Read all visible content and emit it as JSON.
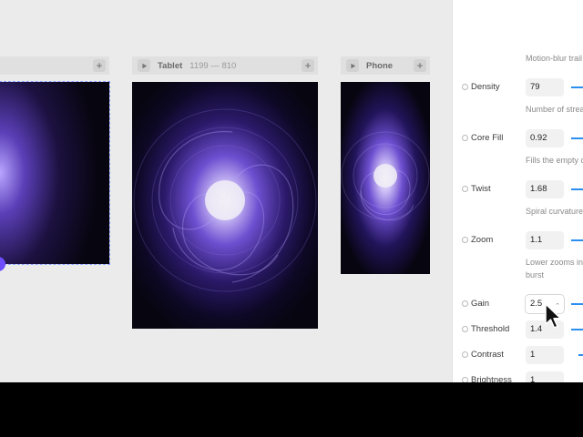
{
  "frames": [
    {
      "title": "",
      "dims": ""
    },
    {
      "title": "Tablet",
      "dims": "1199 — 810"
    },
    {
      "title": "Phone",
      "dims": ""
    }
  ],
  "panel": {
    "top_caption": "Motion-blur trail",
    "params": [
      {
        "label": "Density",
        "value": "79",
        "caption": "Number of streaks"
      },
      {
        "label": "Core Fill",
        "value": "0.92",
        "caption": "Fills the empty center"
      },
      {
        "label": "Twist",
        "value": "1.68",
        "caption": "Spiral curvature"
      },
      {
        "label": "Zoom",
        "value": "1.1",
        "caption_line1": "Lower zooms into",
        "caption_line2": "burst"
      },
      {
        "label": "Gain",
        "value": "2.5"
      },
      {
        "label": "Threshold",
        "value": "1.4"
      },
      {
        "label": "Contrast",
        "value": "1"
      },
      {
        "label": "Brightness",
        "value": "1"
      }
    ]
  },
  "colors": {
    "accent": "#2a8ff0",
    "selection": "#6e4dff",
    "preview_bg": "#07050f"
  },
  "icons": {
    "play": "play-icon",
    "plus": "plus-icon",
    "param": "parameter-dot-icon",
    "cursor": "mouse-pointer-icon"
  }
}
